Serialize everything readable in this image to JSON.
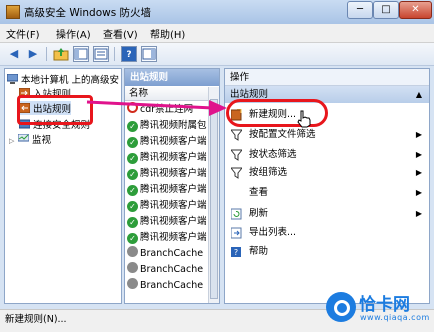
{
  "window": {
    "title": "高级安全 Windows 防火墙",
    "min_glyph": "─",
    "max_glyph": "□",
    "close_glyph": "✕"
  },
  "menu": [
    "文件(F)",
    "操作(A)",
    "查看(V)",
    "帮助(H)"
  ],
  "toolbar": {
    "back_glyph": "◀",
    "forward_glyph": "▶",
    "help_glyph": "?"
  },
  "tree": {
    "root": "本地计算机 上的高级安",
    "inbound": "入站规则",
    "outbound": "出站规则",
    "connection_security": "连接安全规则",
    "monitor": "监视"
  },
  "middle": {
    "header": "出站规则",
    "column": "名称",
    "rows": [
      {
        "status": "blocked",
        "name": "cdr禁止连网"
      },
      {
        "status": "allowed",
        "name": "腾讯视频附属包"
      },
      {
        "status": "allowed",
        "name": "腾讯视频客户端"
      },
      {
        "status": "allowed",
        "name": "腾讯视频客户端"
      },
      {
        "status": "allowed",
        "name": "腾讯视频客户端"
      },
      {
        "status": "allowed",
        "name": "腾讯视频客户端"
      },
      {
        "status": "allowed",
        "name": "腾讯视频客户端"
      },
      {
        "status": "allowed",
        "name": "腾讯视频客户端"
      },
      {
        "status": "allowed",
        "name": "腾讯视频客户端"
      },
      {
        "status": "disabled",
        "name": "BranchCache"
      },
      {
        "status": "disabled",
        "name": "BranchCache"
      },
      {
        "status": "disabled",
        "name": "BranchCache"
      }
    ]
  },
  "actions": {
    "header": "操作",
    "section": "出站规则",
    "items": [
      {
        "icon": "new-rule-icon",
        "label": "新建规则...",
        "submenu": false
      },
      {
        "icon": "filter-icon",
        "label": "按配置文件筛选",
        "submenu": true
      },
      {
        "icon": "filter-icon",
        "label": "按状态筛选",
        "submenu": true
      },
      {
        "icon": "filter-icon",
        "label": "按组筛选",
        "submenu": true
      },
      {
        "icon": "none",
        "label": "查看",
        "submenu": true
      },
      {
        "icon": "refresh-icon",
        "label": "刷新",
        "submenu": true
      },
      {
        "icon": "export-icon",
        "label": "导出列表...",
        "submenu": false
      },
      {
        "icon": "help-icon",
        "label": "帮助",
        "submenu": false
      }
    ]
  },
  "statusbar": {
    "text": "新建规则(N)..."
  },
  "watermark": {
    "brand": "恰卡网",
    "url": "www.qiaqa.com"
  },
  "colors": {
    "annotation": "#e8161c",
    "arrow": "#e0138c",
    "watermark": "#1c7ce0",
    "allowed": "#2d9d3a"
  }
}
